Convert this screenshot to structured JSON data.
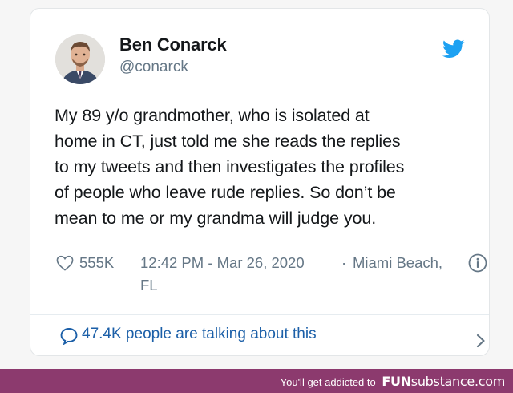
{
  "tweet": {
    "author_name": "Ben Conarck",
    "author_handle": "@conarck",
    "text_lines": [
      "My 89 y/o grandmother, who is isolated at",
      "home in CT, just told me she reads the replies",
      "to my tweets and then investigates the profiles",
      "of people who leave rude replies. So don’t be",
      "mean to me or my grandma will judge you."
    ],
    "likes": "555K",
    "time": "12:42 PM - Mar 26, 2020",
    "separator": "·",
    "location_line1": "Miami Beach,",
    "location_line2": "FL",
    "talking": "47.4K people are talking about this"
  },
  "footer": {
    "tagline": "You'll get addicted to",
    "brand_fun": "FUN",
    "brand_rest": "substance",
    "brand_tld": ".com"
  },
  "colors": {
    "accent": "#1da1f2",
    "link": "#1b5fa8",
    "muted": "#657786",
    "footer_bg": "#8c3a6e"
  },
  "icons": {
    "bird": "twitter-bird-icon",
    "heart": "heart-icon",
    "info": "info-icon",
    "bubble": "speech-bubble-icon",
    "chevron": "chevron-right-icon"
  }
}
